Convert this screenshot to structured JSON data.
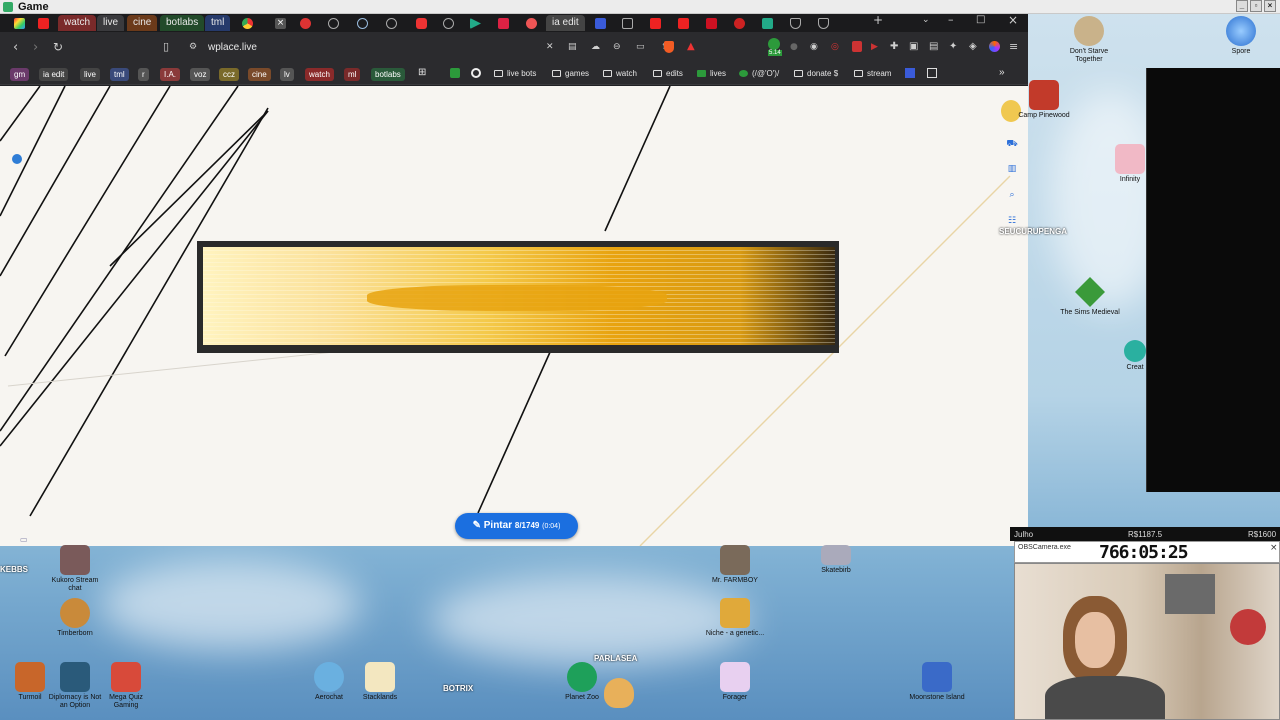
{
  "window": {
    "title": "Game"
  },
  "tabs": [
    {
      "label": "watch"
    },
    {
      "label": "live"
    },
    {
      "label": "cine"
    },
    {
      "label": "botlabs"
    },
    {
      "label": "tml"
    },
    {
      "label": "ia edit"
    }
  ],
  "address_bar": {
    "url": "wplace.live"
  },
  "bookmark_chips": [
    "gm",
    "ia edit",
    "live",
    "tml",
    "r",
    "I.A.",
    "voz",
    "ccz",
    "cine",
    "lv",
    "watch",
    "ml",
    "botlabs"
  ],
  "bookmarks": [
    "live bots",
    "games",
    "watch",
    "edits",
    "lives",
    "(/@'O')/",
    "donate $",
    "stream"
  ],
  "extension_badge": "5.14",
  "canvas": {
    "paint_button": {
      "label": "Pintar",
      "count": "8/1749",
      "timer": "(0:04)"
    },
    "username_label": "SEUCURUPENGA"
  },
  "desktop_icons": [
    {
      "label": "Don't Starve Together"
    },
    {
      "label": "Spore"
    },
    {
      "label": "Camp Pinewood"
    },
    {
      "label": "Infinity"
    },
    {
      "label": "The Sims Medieval"
    },
    {
      "label": "Creat"
    },
    {
      "label": "Kukoro Stream chat"
    },
    {
      "label": "Timberborn"
    },
    {
      "label": "Mr. FARMBOY"
    },
    {
      "label": "Niche - a genetic..."
    },
    {
      "label": "Skatebirb"
    },
    {
      "label": "Turmoil"
    },
    {
      "label": "Diplomacy is Not an Option"
    },
    {
      "label": "Mega Quiz Gaming"
    },
    {
      "label": "Aerochat"
    },
    {
      "label": "Stacklands"
    },
    {
      "label": "Planet Zoo"
    },
    {
      "label": "Forager"
    },
    {
      "label": "Moonstone Island"
    }
  ],
  "overlay_texts": {
    "botrix": "BOTRIX",
    "parlasea": "PARLASEA",
    "kebbs": "KEBBS"
  },
  "stream": {
    "month_label": "Julho",
    "amount_left": "R$1187.5",
    "amount_right": "R$1600",
    "camera_title": "OBSCamera.exe",
    "timer": "766:05:25"
  },
  "colors": {
    "accent": "#1b6fe0",
    "art_gold": "#e8a30f",
    "art_cream": "#fbe7a1",
    "art_frame": "#2a2a2a"
  }
}
